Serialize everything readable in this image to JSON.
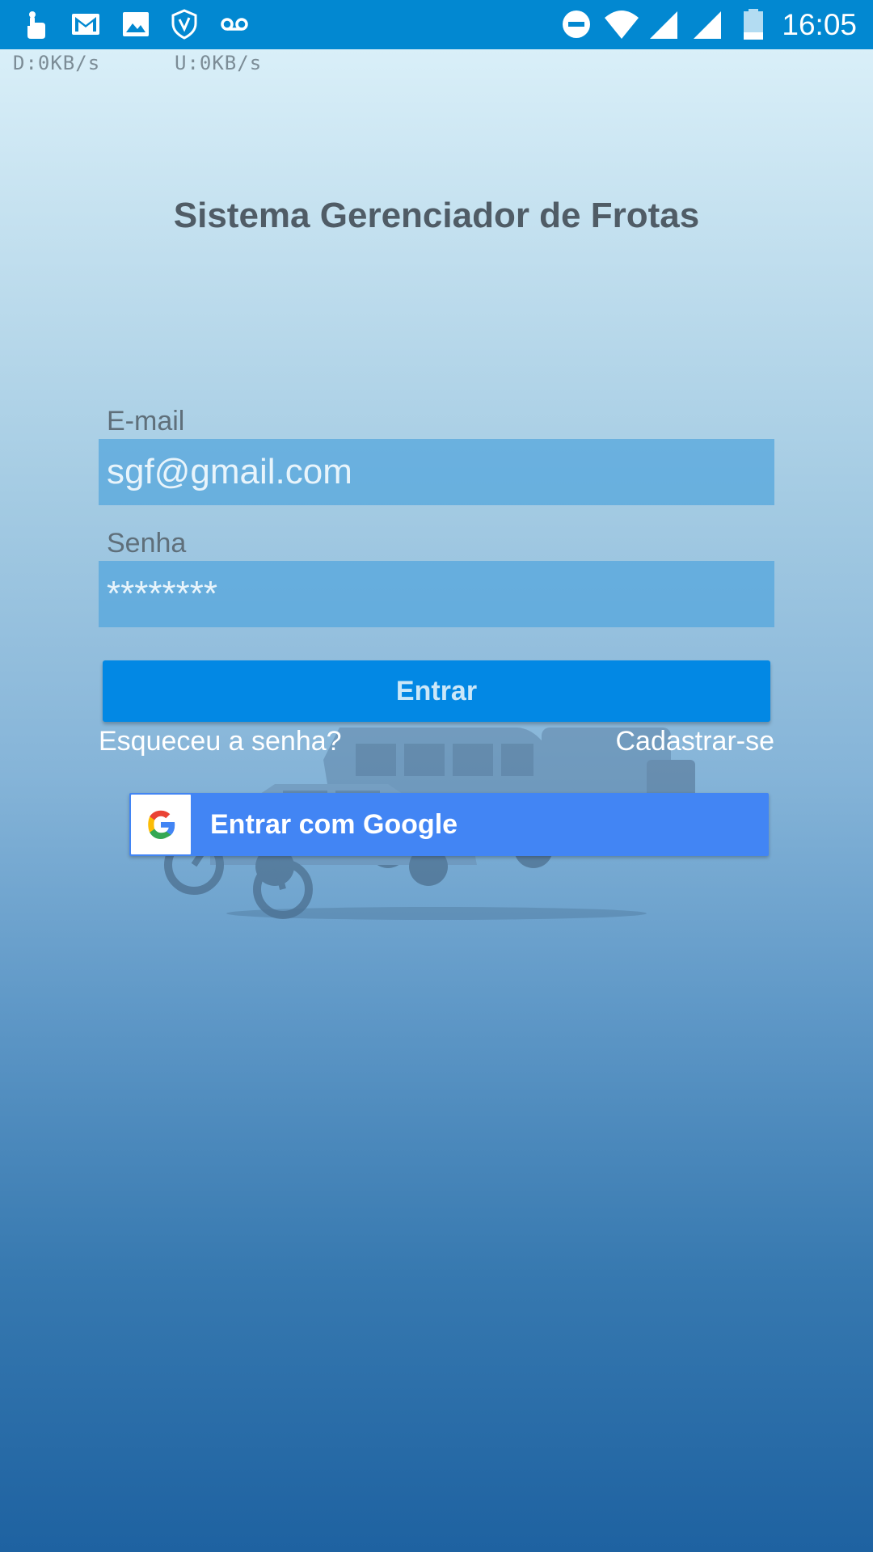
{
  "status_bar": {
    "time": "16:05",
    "left_icons": [
      "touch-icon",
      "gmail-icon",
      "image-icon",
      "shield-icon",
      "voicemail-icon"
    ],
    "right_icons": [
      "do-not-disturb-icon",
      "wifi-icon",
      "signal-icon",
      "signal-icon-2",
      "battery-icon"
    ],
    "background": "#0288d1"
  },
  "net_speed": {
    "download": "D:0KB/s",
    "upload": "U:0KB/s"
  },
  "app": {
    "title": "Sistema Gerenciador de Frotas"
  },
  "form": {
    "email_label": "E-mail",
    "email_value": "sgf@gmail.com",
    "password_label": "Senha",
    "password_value": "********",
    "login_button": "Entrar",
    "forgot_password": "Esqueceu a senha?",
    "register": "Cadastrar-se",
    "google_button": "Entrar com Google"
  },
  "colors": {
    "login_button": "#0288e4",
    "google_button": "#4285f4",
    "input_background": "#52a5dc"
  }
}
